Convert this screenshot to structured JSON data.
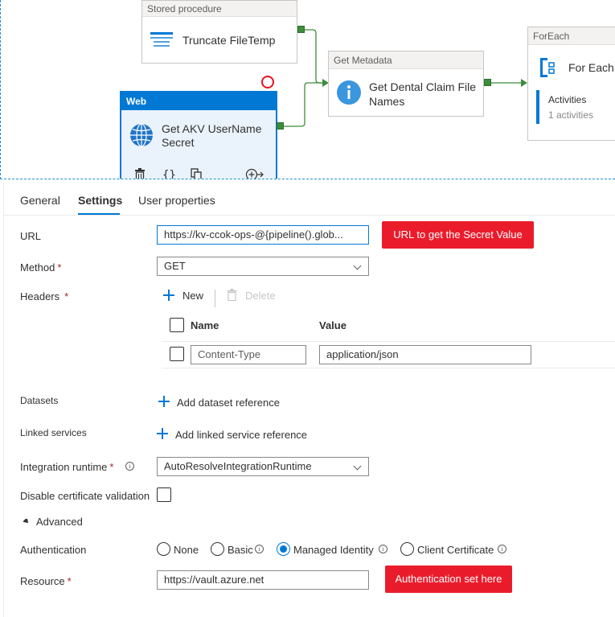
{
  "canvas": {
    "stored_procedure": {
      "type": "Stored procedure",
      "name": "Truncate FileTemp"
    },
    "get_metadata": {
      "type": "Get Metadata",
      "name_line1": "Get Dental Claim File",
      "name_line2": "Names"
    },
    "foreach": {
      "type": "ForEach",
      "name": "For Each F",
      "activities_label": "Activities",
      "activities_count": "1 activities"
    },
    "web": {
      "type": "Web",
      "name_line1": "Get AKV UserName",
      "name_line2": "Secret"
    }
  },
  "tabs": [
    {
      "label": "General"
    },
    {
      "label": "Settings"
    },
    {
      "label": "User properties"
    }
  ],
  "settings": {
    "url_label": "URL",
    "url_value": "https://kv-ccok-ops-@{pipeline().glob...",
    "url_callout": "URL to get the Secret Value",
    "method_label": "Method",
    "method_value": "GET",
    "headers_label": "Headers",
    "new_label": "New",
    "delete_label": "Delete",
    "col_name": "Name",
    "col_value": "Value",
    "header_name": "Content-Type",
    "header_value": "application/json",
    "datasets_label": "Datasets",
    "add_dataset": "Add dataset reference",
    "linked_services_label": "Linked services",
    "add_linked_service": "Add linked service reference",
    "integration_runtime_label": "Integration runtime",
    "integration_runtime_value": "AutoResolveIntegrationRuntime",
    "disable_cert_label": "Disable certificate validation",
    "advanced_label": "Advanced",
    "authentication_label": "Authentication",
    "auth_options": [
      "None",
      "Basic",
      "Managed Identity",
      "Client Certificate"
    ],
    "auth_selected": "Managed Identity",
    "resource_label": "Resource",
    "resource_value": "https://vault.azure.net",
    "resource_callout": "Authentication set here",
    "required_mark": "*"
  },
  "colors": {
    "accent": "#0078d4",
    "callout": "#ea1c2c",
    "port": "#3c8c3c"
  }
}
